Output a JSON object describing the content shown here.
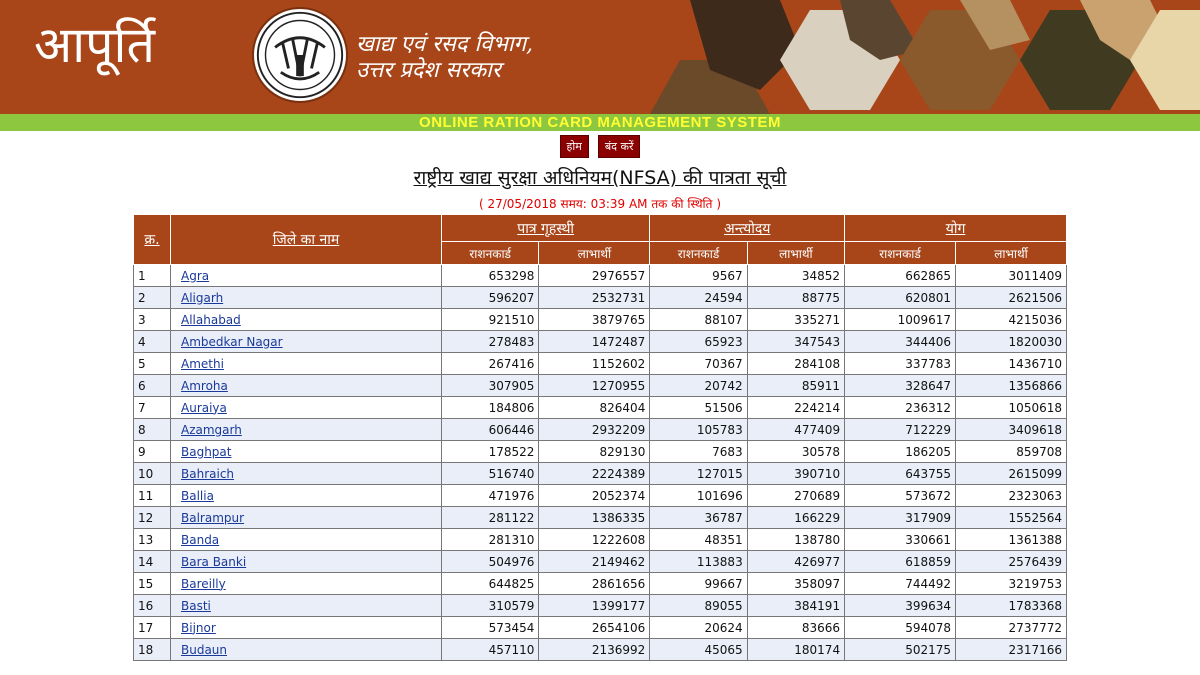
{
  "header": {
    "brand": "आपूर्ति",
    "dept_line1": "खाद्य एवं रसद विभाग,",
    "dept_line2": "उत्तर प्रदेश सरकार"
  },
  "banner": "ONLINE RATION CARD MANAGEMENT SYSTEM",
  "nav": {
    "home": "होम",
    "close": "बंद करें"
  },
  "page_title": "राष्ट्रीय खाद्य सुरक्षा अधिनियम(NFSA) की पात्रता सूची",
  "status": "( 27/05/2018 समय: 03:39 AM तक की स्थिति )",
  "table": {
    "col_sn": "क्र.",
    "col_district": "जिले का नाम",
    "groups": [
      "पात्र गृहस्थी",
      "अन्त्योदय",
      "योग"
    ],
    "sub_card": "राशनकार्ड",
    "sub_beneficiary": "लाभार्थी",
    "rows": [
      {
        "sn": "1",
        "district": "Agra",
        "v": [
          "653298",
          "2976557",
          "9567",
          "34852",
          "662865",
          "3011409"
        ]
      },
      {
        "sn": "2",
        "district": "Aligarh",
        "v": [
          "596207",
          "2532731",
          "24594",
          "88775",
          "620801",
          "2621506"
        ]
      },
      {
        "sn": "3",
        "district": "Allahabad",
        "v": [
          "921510",
          "3879765",
          "88107",
          "335271",
          "1009617",
          "4215036"
        ]
      },
      {
        "sn": "4",
        "district": "Ambedkar Nagar",
        "v": [
          "278483",
          "1472487",
          "65923",
          "347543",
          "344406",
          "1820030"
        ]
      },
      {
        "sn": "5",
        "district": "Amethi",
        "v": [
          "267416",
          "1152602",
          "70367",
          "284108",
          "337783",
          "1436710"
        ]
      },
      {
        "sn": "6",
        "district": "Amroha",
        "v": [
          "307905",
          "1270955",
          "20742",
          "85911",
          "328647",
          "1356866"
        ]
      },
      {
        "sn": "7",
        "district": "Auraiya",
        "v": [
          "184806",
          "826404",
          "51506",
          "224214",
          "236312",
          "1050618"
        ]
      },
      {
        "sn": "8",
        "district": "Azamgarh",
        "v": [
          "606446",
          "2932209",
          "105783",
          "477409",
          "712229",
          "3409618"
        ]
      },
      {
        "sn": "9",
        "district": "Baghpat",
        "v": [
          "178522",
          "829130",
          "7683",
          "30578",
          "186205",
          "859708"
        ]
      },
      {
        "sn": "10",
        "district": "Bahraich",
        "v": [
          "516740",
          "2224389",
          "127015",
          "390710",
          "643755",
          "2615099"
        ]
      },
      {
        "sn": "11",
        "district": "Ballia",
        "v": [
          "471976",
          "2052374",
          "101696",
          "270689",
          "573672",
          "2323063"
        ]
      },
      {
        "sn": "12",
        "district": "Balrampur",
        "v": [
          "281122",
          "1386335",
          "36787",
          "166229",
          "317909",
          "1552564"
        ]
      },
      {
        "sn": "13",
        "district": "Banda",
        "v": [
          "281310",
          "1222608",
          "48351",
          "138780",
          "330661",
          "1361388"
        ]
      },
      {
        "sn": "14",
        "district": "Bara Banki",
        "v": [
          "504976",
          "2149462",
          "113883",
          "426977",
          "618859",
          "2576439"
        ]
      },
      {
        "sn": "15",
        "district": "Bareilly",
        "v": [
          "644825",
          "2861656",
          "99667",
          "358097",
          "744492",
          "3219753"
        ]
      },
      {
        "sn": "16",
        "district": "Basti",
        "v": [
          "310579",
          "1399177",
          "89055",
          "384191",
          "399634",
          "1783368"
        ]
      },
      {
        "sn": "17",
        "district": "Bijnor",
        "v": [
          "573454",
          "2654106",
          "20624",
          "83666",
          "594078",
          "2737772"
        ]
      },
      {
        "sn": "18",
        "district": "Budaun",
        "v": [
          "457110",
          "2136992",
          "45065",
          "180174",
          "502175",
          "2317166"
        ]
      }
    ]
  },
  "colors": {
    "header_bg": "#a8461a",
    "banner_bg": "#8dc63f",
    "banner_text": "#ffff33",
    "nav_btn": "#8b0000",
    "status_text": "#e00000"
  }
}
